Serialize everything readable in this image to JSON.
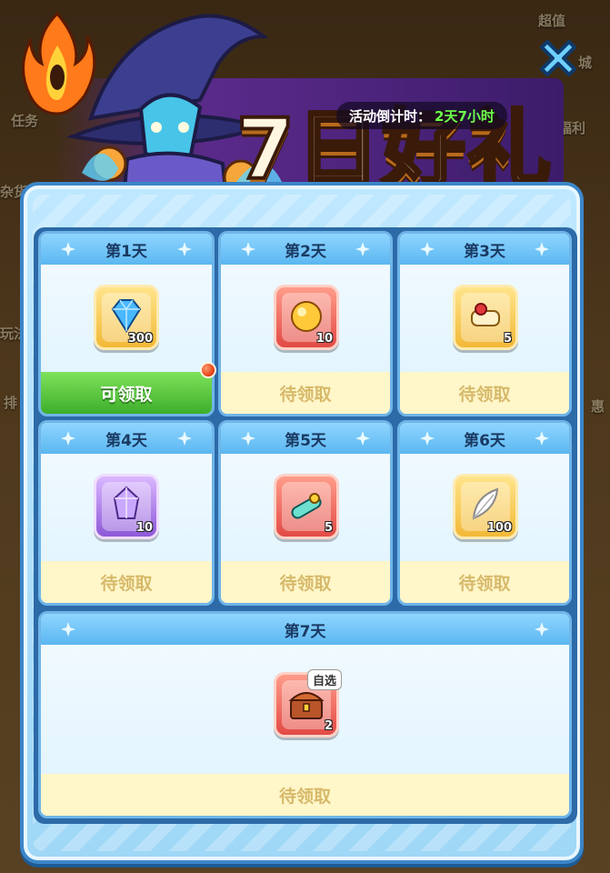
{
  "title": "7日好礼",
  "countdown": {
    "label": "活动倒计时：",
    "value": "2天7小时"
  },
  "background_labels": [
    "任务",
    "福利",
    "超值",
    "城",
    "排",
    "玩法",
    "杂货",
    "惠"
  ],
  "days": [
    {
      "label": "第1天",
      "item": "diamond",
      "qty": "300",
      "status": "可领取",
      "claimable": true
    },
    {
      "label": "第2天",
      "item": "gold-orb",
      "qty": "10",
      "status": "待领取",
      "claimable": false
    },
    {
      "label": "第3天",
      "item": "scroll",
      "qty": "5",
      "status": "待领取",
      "claimable": false
    },
    {
      "label": "第4天",
      "item": "crystal",
      "qty": "10",
      "status": "待领取",
      "claimable": false
    },
    {
      "label": "第5天",
      "item": "summon-scroll",
      "qty": "5",
      "status": "待领取",
      "claimable": false
    },
    {
      "label": "第6天",
      "item": "feather",
      "qty": "100",
      "status": "待领取",
      "claimable": false
    },
    {
      "label": "第7天",
      "item": "treasure-chest",
      "qty": "2",
      "tag": "自选",
      "status": "待领取",
      "claimable": false
    }
  ],
  "colors": {
    "ready": "#3eae2c",
    "pending_text": "#d7b96a",
    "countdown_value": "#6cff4a",
    "panel_border": "#3b86c9"
  }
}
